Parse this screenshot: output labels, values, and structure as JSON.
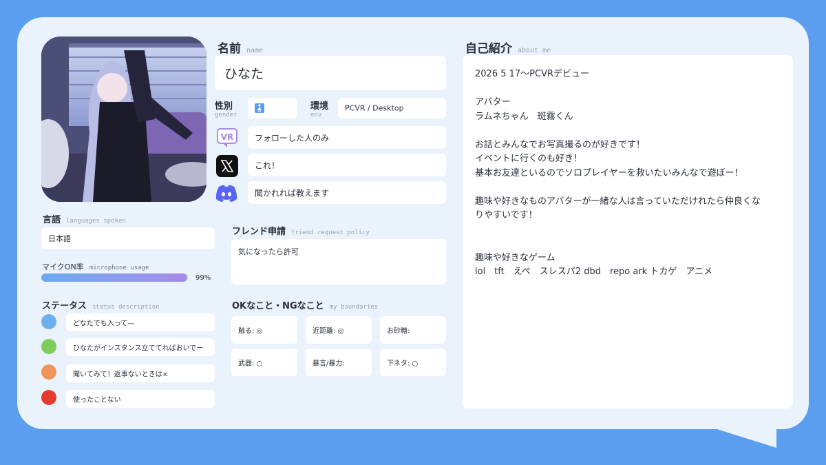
{
  "profile": {
    "name_label": "名前",
    "name_sub": "name",
    "name_value": "ひなた",
    "gender_label": "性別",
    "gender_sub": "gender",
    "env_label": "環境",
    "env_sub": "env",
    "env_value": "PCVR / Desktop",
    "vr_value": "フォローした人のみ",
    "x_value": "これ！",
    "discord_value": "聞かれれば教えます",
    "gender_icon": "female-restroom-icon"
  },
  "languages": {
    "label": "言語",
    "sub": "languages spoken",
    "value": "日本語"
  },
  "mic": {
    "label": "マイクON率",
    "sub": "microphone usage",
    "percent_text": "99%",
    "percent": 99
  },
  "status": {
    "label": "ステータス",
    "sub": "status description",
    "items": [
      {
        "color": "#6db0ee",
        "text": "どなたでも入って—"
      },
      {
        "color": "#7ccd5a",
        "text": "ひなたがインスタンス立ててればおいでー"
      },
      {
        "color": "#f0955a",
        "text": "聞いてみて！返事ないときは×"
      },
      {
        "color": "#e53a30",
        "text": "使ったことない"
      }
    ]
  },
  "friend": {
    "label": "フレンド申請",
    "sub": "friend request policy",
    "value": "気になったら許可"
  },
  "boundaries": {
    "label": "OKなこと・NGなこと",
    "sub": "my boundaries",
    "items": [
      "触る: ◎",
      "近距離: ◎",
      "お砂糖:",
      "武器: ○",
      "暴言/暴力:",
      "下ネタ: ○"
    ]
  },
  "about": {
    "label": "自己紹介",
    "sub": "about me",
    "text": "2026 5 17〜PCVRデビュー\n\nアバター\nラムネちゃん　斑霧くん\n\nお話とみんなでお写真撮るのが好きです！\nイベントに行くのも好き！\n基本お友達といるのでソロプレイヤーを救いたいみんなで遊ぼー！\n\n趣味や好きなものアバターが一緒な人は言っていただけれたら仲良くな\nりやすいです！\n\n\n趣味や好きなゲーム\nlol　tft　えぺ　スレスパ2 dbd　repo ark トカゲ　アニメ"
  },
  "colors": {
    "background": "#5b9ef0",
    "card": "#eaf2fc",
    "field": "#ffffff"
  }
}
